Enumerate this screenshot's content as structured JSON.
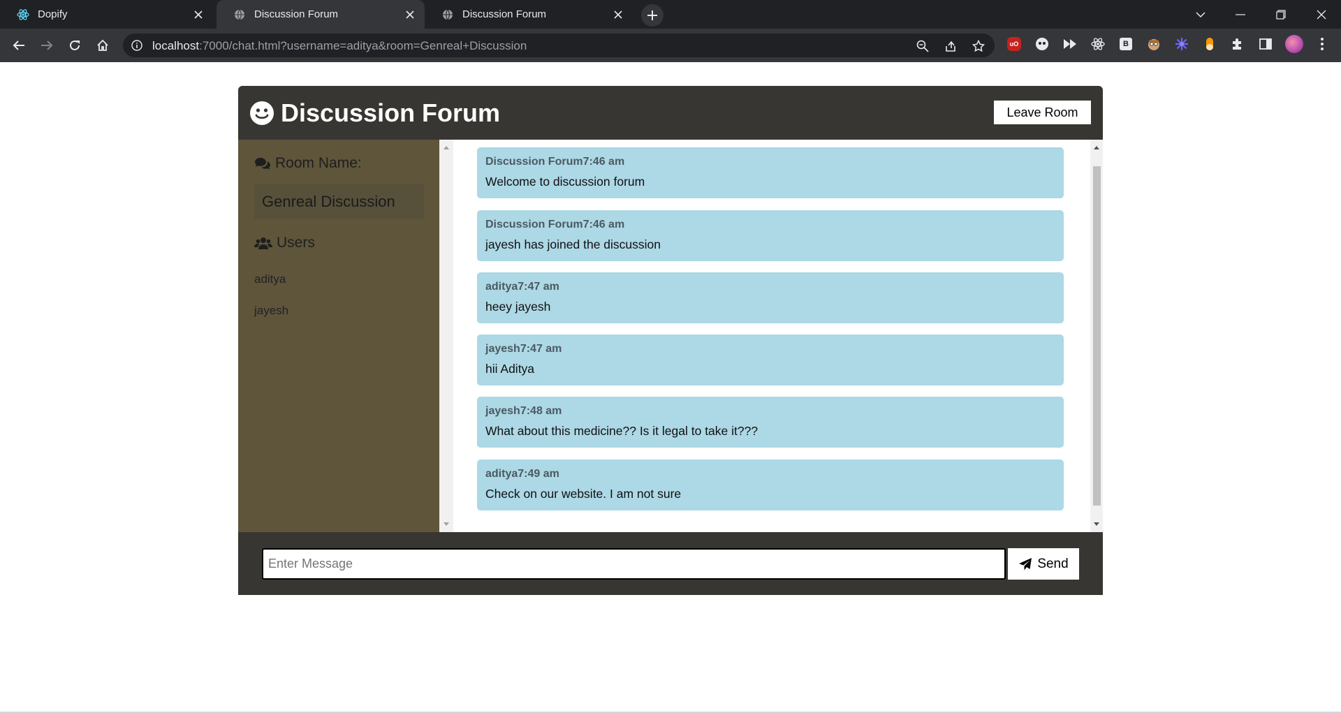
{
  "browser": {
    "tabs": [
      {
        "title": "Dopify",
        "icon": "react-icon",
        "active": false
      },
      {
        "title": "Discussion Forum",
        "icon": "globe-icon",
        "active": true
      },
      {
        "title": "Discussion Forum",
        "icon": "globe-icon",
        "active": false
      }
    ],
    "url_host": "localhost",
    "url_rest": ":7000/chat.html?username=aditya&room=Genreal+Discussion",
    "extension_b_label": "B",
    "extension_ub_label": "uO"
  },
  "header": {
    "title": "Discussion Forum",
    "leave_label": "Leave Room"
  },
  "sidebar": {
    "room_heading": "Room Name:",
    "room_name": "Genreal Discussion",
    "users_heading": "Users",
    "users": [
      "aditya",
      "jayesh"
    ]
  },
  "messages": [
    {
      "author": "Discussion Forum",
      "time": "7:46 am",
      "text": "Welcome to discussion forum"
    },
    {
      "author": "Discussion Forum",
      "time": "7:46 am",
      "text": "jayesh has joined the discussion"
    },
    {
      "author": "aditya",
      "time": "7:47 am",
      "text": "heey jayesh"
    },
    {
      "author": "jayesh",
      "time": "7:47 am",
      "text": "hii Aditya"
    },
    {
      "author": "jayesh",
      "time": "7:48 am",
      "text": "What about this medicine?? Is it legal to take it???"
    },
    {
      "author": "aditya",
      "time": "7:49 am",
      "text": "Check on our website. I am not sure"
    }
  ],
  "composer": {
    "placeholder": "Enter Message",
    "value": "",
    "send_label": "Send"
  },
  "colors": {
    "header_bg": "#373632",
    "sidebar_bg": "#5e553b",
    "message_bg": "#add8e6"
  }
}
